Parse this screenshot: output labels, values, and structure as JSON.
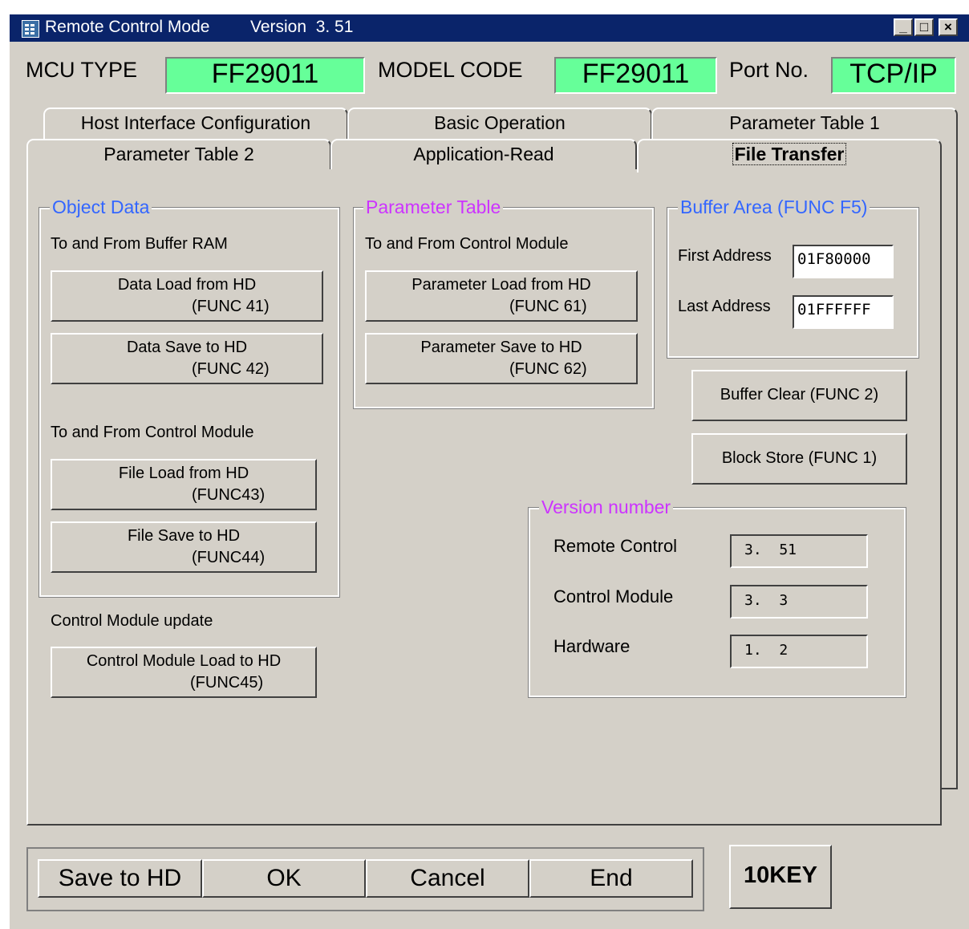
{
  "window": {
    "title": "Remote Control Mode",
    "version_text": "Version  3. 51",
    "controls": {
      "minimize": "_",
      "maximize": "□",
      "close": "×"
    }
  },
  "header": {
    "mcu_type_label": "MCU TYPE",
    "mcu_type_value": "FF29011",
    "model_code_label": "MODEL CODE",
    "model_code_value": "FF29011",
    "port_label": "Port No.",
    "port_value": "TCP/IP",
    "field_color": "#66ff99"
  },
  "tabs": {
    "row1": [
      "Host Interface Configuration",
      "Basic Operation",
      "Parameter Table 1"
    ],
    "row2": [
      "Parameter Table 2",
      "Application-Read",
      "File Transfer"
    ],
    "active": "File Transfer"
  },
  "object_data": {
    "title": "Object Data",
    "title_color": "#3366ff",
    "buffer_subtitle": "To and From Buffer RAM",
    "data_load": {
      "line1": "Data Load from HD",
      "line2": "(FUNC 41)"
    },
    "data_save": {
      "line1": "Data Save to HD",
      "line2": "(FUNC 42)"
    },
    "module_subtitle": "To and From Control Module",
    "file_load": {
      "line1": "File Load from HD",
      "line2": "(FUNC43)"
    },
    "file_save": {
      "line1": "File Save to HD",
      "line2": "(FUNC44)"
    }
  },
  "update": {
    "label": "Control Module update",
    "button": {
      "line1": "Control Module Load to HD",
      "line2": "(FUNC45)"
    }
  },
  "parameter_table": {
    "title": "Parameter Table",
    "title_color": "#cc33ff",
    "subtitle": "To and From Control Module",
    "load": {
      "line1": "Parameter Load from HD",
      "line2": "(FUNC 61)"
    },
    "save": {
      "line1": "Parameter Save to HD",
      "line2": "(FUNC 62)"
    }
  },
  "buffer_area": {
    "title": "Buffer Area (FUNC F5)",
    "title_color": "#3366ff",
    "first_label": "First  Address",
    "first_value": "01F80000",
    "last_label": "Last  Address",
    "last_value": "01FFFFFF"
  },
  "actions": {
    "buffer_clear": "Buffer Clear (FUNC 2)",
    "block_store": "Block Store (FUNC 1)"
  },
  "version_number": {
    "title": "Version number",
    "title_color": "#cc33ff",
    "items": [
      {
        "label": "Remote Control",
        "value": "3.  51"
      },
      {
        "label": "Control Module",
        "value": "3.  3"
      },
      {
        "label": "Hardware",
        "value": "1.  2"
      }
    ]
  },
  "bottom": {
    "save": "Save to HD",
    "ok": "OK",
    "cancel": "Cancel",
    "end": "End",
    "tenkey": "10KEY"
  }
}
